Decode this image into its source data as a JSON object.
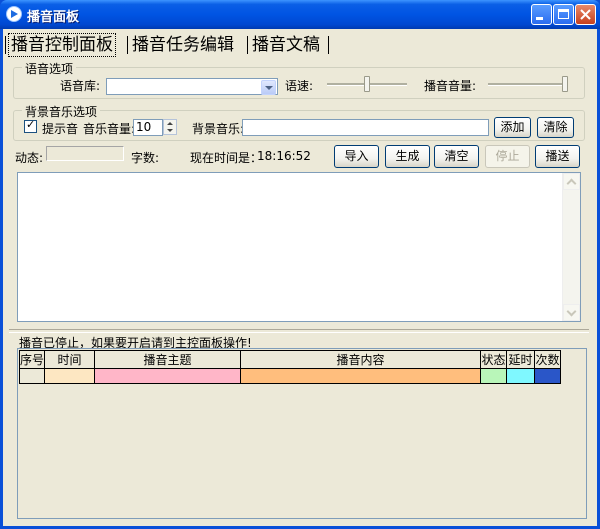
{
  "window": {
    "title": "播音面板"
  },
  "tabs": [
    {
      "label": "播音控制面板"
    },
    {
      "label": "播音任务编辑"
    },
    {
      "label": "播音文稿"
    }
  ],
  "voice_options": {
    "group_title": "语音选项",
    "library_label": "语音库:",
    "library_value": "",
    "speed_label": "语速:",
    "speed_level": 0.5,
    "volume_label": "播音音量:",
    "volume_level": 1.0
  },
  "bgm_options": {
    "group_title": "背景音乐选项",
    "prompt_tone_label": "提示音",
    "prompt_tone_checked": true,
    "music_volume_label": "音乐音量:",
    "music_volume_value": "10",
    "bgm_label": "背景音乐:",
    "bgm_value": "",
    "add_button": "添加",
    "clear_button": "清除"
  },
  "status_row": {
    "dynamic_label": "动态:",
    "char_count_label": "字数:",
    "current_time_label": "现在时间是：",
    "current_time_value": "18:16:52"
  },
  "actions": {
    "import": "导入",
    "generate": "生成",
    "clear": "清空",
    "stop": "停止",
    "broadcast": "播送"
  },
  "editor": {
    "content": ""
  },
  "grid": {
    "title": "播音已停止，如果要开启请到主控面板操作!",
    "columns": [
      "序号",
      "时间",
      "播音主题",
      "播音内容",
      "状态",
      "延时",
      "次数"
    ],
    "column_colors": [
      "#ece9d8",
      "#fde7c2",
      "#ffb6c8",
      "#ffbe7d",
      "#b9f6b9",
      "#7ff8ff",
      "#2a56c8"
    ]
  }
}
